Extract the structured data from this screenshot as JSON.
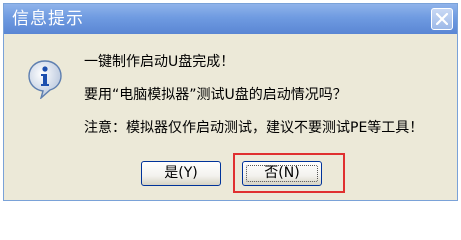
{
  "dialog": {
    "title": "信息提示",
    "icon": "info-icon",
    "messages": [
      "一键制作启动U盘完成！",
      "要用“电脑模拟器”测试U盘的启动情况吗？",
      "注意：模拟器仅作启动测试，建议不要测试PE等工具！"
    ],
    "buttons": {
      "yes_label": "是(Y)",
      "no_label": "否(N)"
    },
    "highlight_color": "#e03030",
    "titlebar_color": "#6f9be1"
  }
}
